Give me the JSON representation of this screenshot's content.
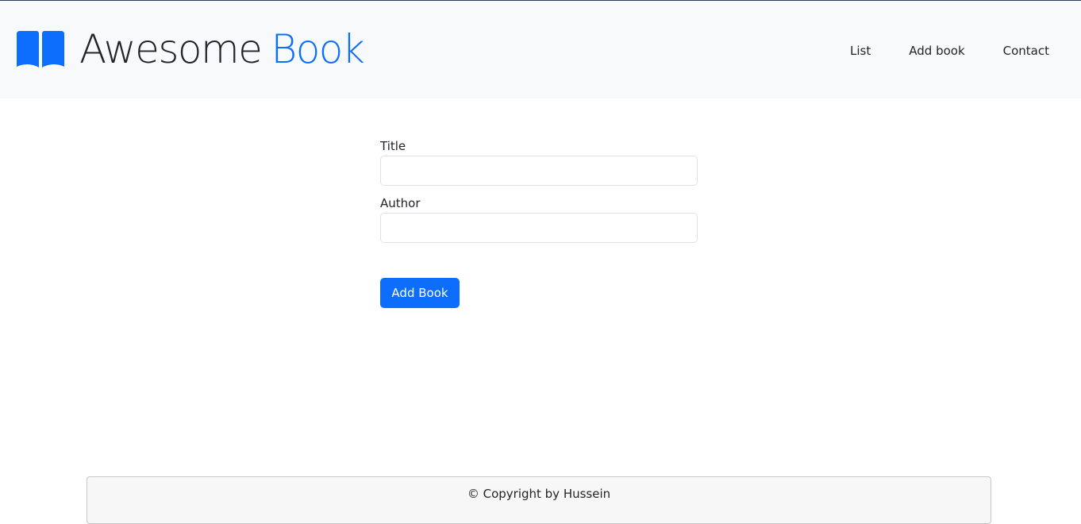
{
  "brand": {
    "name_main": "Awesome",
    "name_accent": "Book",
    "icon": "book-open-icon",
    "accent_color": "#0d6efd"
  },
  "nav": {
    "items": [
      {
        "label": "List"
      },
      {
        "label": "Add book"
      },
      {
        "label": "Contact"
      }
    ]
  },
  "form": {
    "title_label": "Title",
    "title_value": "",
    "author_label": "Author",
    "author_value": "",
    "submit_label": "Add Book",
    "button_color": "#0d6efd"
  },
  "footer": {
    "text": "© Copyright by Hussein"
  }
}
